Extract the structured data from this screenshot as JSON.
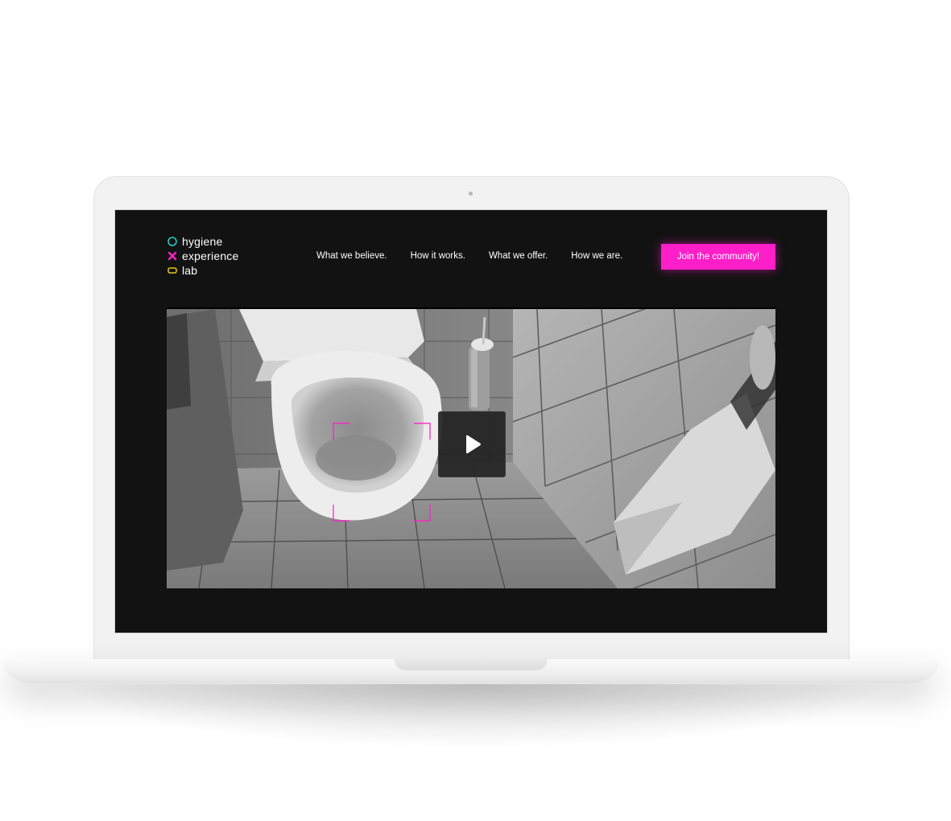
{
  "logo": {
    "line1": "hygiene",
    "line2": "experience",
    "line3": "lab",
    "icons": [
      "circle-icon",
      "cross-icon",
      "rounded-rect-icon"
    ],
    "colors": [
      "#1fd3c6",
      "#ff1fc8",
      "#e8c61a"
    ]
  },
  "nav": {
    "items": [
      {
        "label": "What we believe."
      },
      {
        "label": "How it works."
      },
      {
        "label": "What we offer."
      },
      {
        "label": "How we are."
      }
    ],
    "cta_label": "Join the community!"
  },
  "video": {
    "play_icon": "play-icon",
    "accent": "#ff1fc8"
  },
  "colors": {
    "background": "#121212",
    "accent": "#ff1fc8",
    "text": "#ffffff"
  }
}
